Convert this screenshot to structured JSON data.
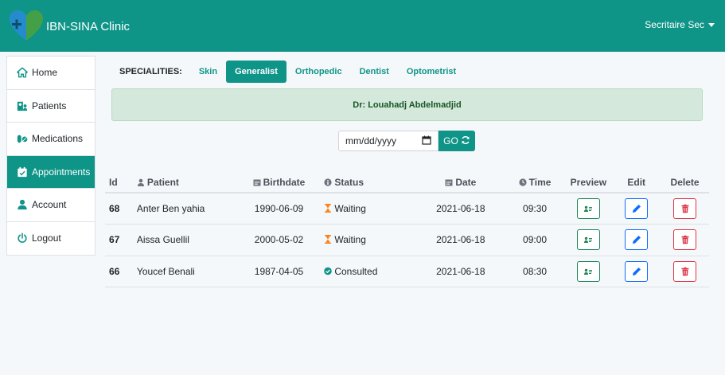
{
  "navbar": {
    "brand": "IBN-SINA Clinic",
    "user_label": "Secritaire Sec",
    "background": "#0f9488"
  },
  "sidebar": {
    "items": [
      {
        "label": "Home",
        "icon": "home-icon"
      },
      {
        "label": "Patients",
        "icon": "hospital-user-icon"
      },
      {
        "label": "Medications",
        "icon": "pills-icon"
      },
      {
        "label": "Appointments",
        "icon": "calendar-check-icon",
        "active": true
      },
      {
        "label": "Account",
        "icon": "user-icon"
      },
      {
        "label": "Logout",
        "icon": "power-icon"
      }
    ]
  },
  "specialities": {
    "label": "SPECIALITIES:",
    "tabs": [
      "Skin",
      "Generalist",
      "Orthopedic",
      "Dentist",
      "Optometrist"
    ],
    "active": "Generalist"
  },
  "doctor": {
    "name": "Dr: Louahadj Abdelmadjid"
  },
  "date_filter": {
    "placeholder": "mm/dd/yyyy",
    "go_label": "GO"
  },
  "table": {
    "headers": {
      "id": "Id",
      "patient": "Patient",
      "birthdate": "Birthdate",
      "status": "Status",
      "date": "Date",
      "time": "Time",
      "preview": "Preview",
      "edit": "Edit",
      "delete": "Delete"
    },
    "rows": [
      {
        "id": "68",
        "patient": "Anter Ben yahia",
        "birthdate": "1990-06-09",
        "status": "Waiting",
        "date": "2021-06-18",
        "time": "09:30"
      },
      {
        "id": "67",
        "patient": "Aissa Guellil",
        "birthdate": "2000-05-02",
        "status": "Waiting",
        "date": "2021-06-18",
        "time": "09:00"
      },
      {
        "id": "66",
        "patient": "Youcef Benali",
        "birthdate": "1987-04-05",
        "status": "Consulted",
        "date": "2021-06-18",
        "time": "08:30"
      }
    ]
  },
  "colors": {
    "accent": "#0f9488",
    "waiting": "#fd7e14",
    "consulted": "#0f9488",
    "preview": "#198754",
    "edit": "#0d6efd",
    "delete": "#dc3545"
  }
}
